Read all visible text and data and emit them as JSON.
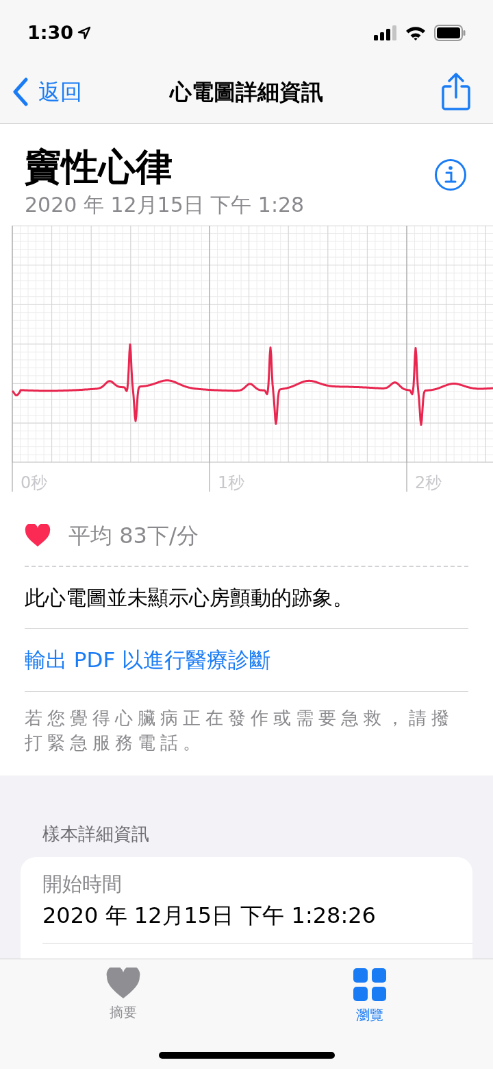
{
  "status_bar": {
    "time": "1:30"
  },
  "nav": {
    "back": "返回",
    "title": "心電圖詳細資訊"
  },
  "header": {
    "title": "竇性心律",
    "date": "2020 年 12月15日 下午 1:28"
  },
  "ecg": {
    "axis_labels": [
      "0秒",
      "1秒",
      "2秒"
    ]
  },
  "average": {
    "text": "平均 83下/分"
  },
  "result": "此心電圖並未顯示心房顫動的跡象。",
  "export_link": "輸出 PDF 以進行醫療診斷",
  "warning": "若您覺得心臟病正在發作或需要急救，請撥打緊急服務電話。",
  "sample": {
    "heading": "樣本詳細資訊",
    "rows": [
      {
        "label": "開始時間",
        "value": "2020 年 12月15日 下午 1:28:26"
      }
    ]
  },
  "tabs": [
    {
      "label": "摘要",
      "selected": false
    },
    {
      "label": "瀏覽",
      "selected": true
    }
  ]
}
